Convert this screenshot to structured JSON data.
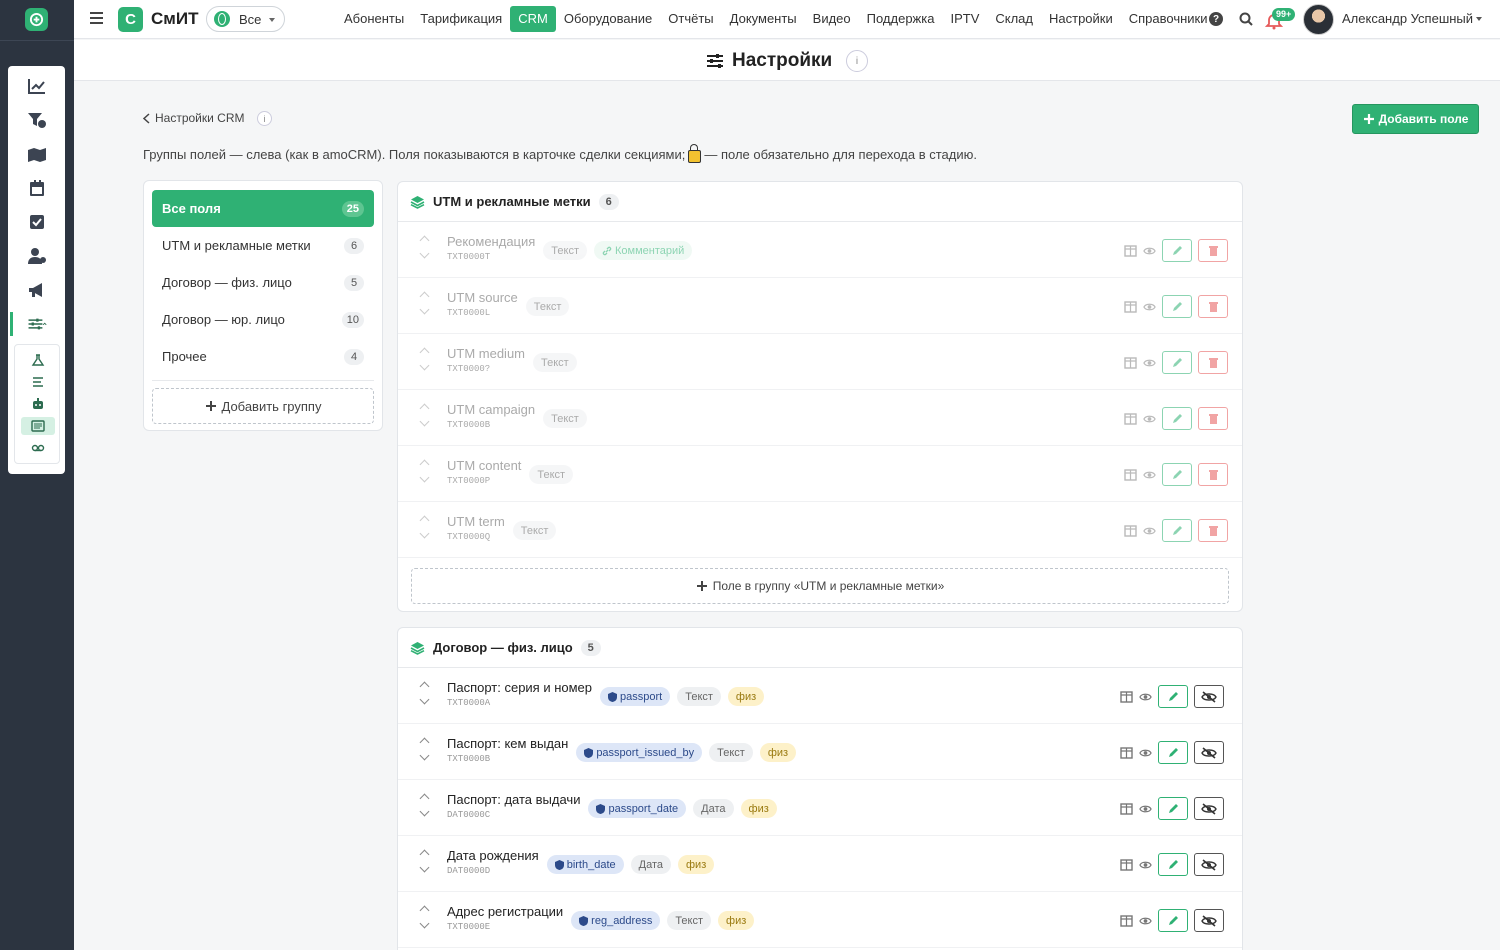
{
  "app": {
    "brand_letter": "С",
    "brand_name": "СмИТ",
    "scope_select": "Все",
    "accent": "#2fb174"
  },
  "nav": [
    "Абоненты",
    "Тарификация",
    "CRM",
    "Оборудование",
    "Отчёты",
    "Документы",
    "Видео",
    "Поддержка",
    "IPTV",
    "Склад",
    "Настройки",
    "Справочники"
  ],
  "nav_active": "CRM",
  "user": {
    "name": "Александр Успешный",
    "notifications": "99+"
  },
  "page": {
    "title": "Настройки",
    "info": "i"
  },
  "crumb": {
    "label": "Настройки CRM"
  },
  "add_field_button": "Добавить поле",
  "description": {
    "before": "Группы полей — слева (как в amoCRM). Поля показываются в карточке сделки секциями;",
    "after": "— поле обязательно для перехода в стадию."
  },
  "groups": [
    {
      "label": "Все поля",
      "count": "25",
      "active": true
    },
    {
      "label": "UTM и рекламные метки",
      "count": "6"
    },
    {
      "label": "Договор — физ. лицо",
      "count": "5"
    },
    {
      "label": "Договор — юр. лицо",
      "count": "10"
    },
    {
      "label": "Прочее",
      "count": "4"
    }
  ],
  "add_group_button": "Добавить группу",
  "sections": [
    {
      "title": "UTM и рекламные метки",
      "count": "6",
      "muted": true,
      "add_label": "Поле в группу «UTM и рекламные метки»",
      "fields": [
        {
          "name": "Рекомендация",
          "code": "TXT0000T",
          "tags": [
            {
              "text": "Текст",
              "kind": "gray"
            },
            {
              "text": "Комментарий",
              "kind": "green",
              "icon": "link-icon"
            }
          ]
        },
        {
          "name": "UTM source",
          "code": "TXT0000L",
          "tags": [
            {
              "text": "Текст",
              "kind": "gray"
            }
          ]
        },
        {
          "name": "UTM medium",
          "code": "TXT0000?",
          "tags": [
            {
              "text": "Текст",
              "kind": "gray"
            }
          ]
        },
        {
          "name": "UTM campaign",
          "code": "TXT0000B",
          "tags": [
            {
              "text": "Текст",
              "kind": "gray"
            }
          ]
        },
        {
          "name": "UTM content",
          "code": "TXT0000P",
          "tags": [
            {
              "text": "Текст",
              "kind": "gray"
            }
          ]
        },
        {
          "name": "UTM term",
          "code": "TXT0000Q",
          "tags": [
            {
              "text": "Текст",
              "kind": "gray"
            }
          ]
        }
      ]
    },
    {
      "title": "Договор — физ. лицо",
      "count": "5",
      "muted": false,
      "fields": [
        {
          "name": "Паспорт: серия и номер",
          "code": "TXT0000A",
          "tags": [
            {
              "text": "passport",
              "kind": "blue",
              "icon": "shield-icon"
            },
            {
              "text": "Текст",
              "kind": "gray"
            },
            {
              "text": "физ",
              "kind": "yellow"
            }
          ]
        },
        {
          "name": "Паспорт: кем выдан",
          "code": "TXT0000B",
          "tags": [
            {
              "text": "passport_issued_by",
              "kind": "blue",
              "icon": "shield-icon"
            },
            {
              "text": "Текст",
              "kind": "gray"
            },
            {
              "text": "физ",
              "kind": "yellow"
            }
          ]
        },
        {
          "name": "Паспорт: дата выдачи",
          "code": "DAT0000C",
          "tags": [
            {
              "text": "passport_date",
              "kind": "blue",
              "icon": "shield-icon"
            },
            {
              "text": "Дата",
              "kind": "gray"
            },
            {
              "text": "физ",
              "kind": "yellow"
            }
          ]
        },
        {
          "name": "Дата рождения",
          "code": "DAT0000D",
          "tags": [
            {
              "text": "birth_date",
              "kind": "blue",
              "icon": "shield-icon"
            },
            {
              "text": "Дата",
              "kind": "gray"
            },
            {
              "text": "физ",
              "kind": "yellow"
            }
          ]
        },
        {
          "name": "Адрес регистрации",
          "code": "TXT0000E",
          "tags": [
            {
              "text": "reg_address",
              "kind": "blue",
              "icon": "shield-icon"
            },
            {
              "text": "Текст",
              "kind": "gray"
            },
            {
              "text": "физ",
              "kind": "yellow"
            }
          ]
        }
      ]
    }
  ]
}
